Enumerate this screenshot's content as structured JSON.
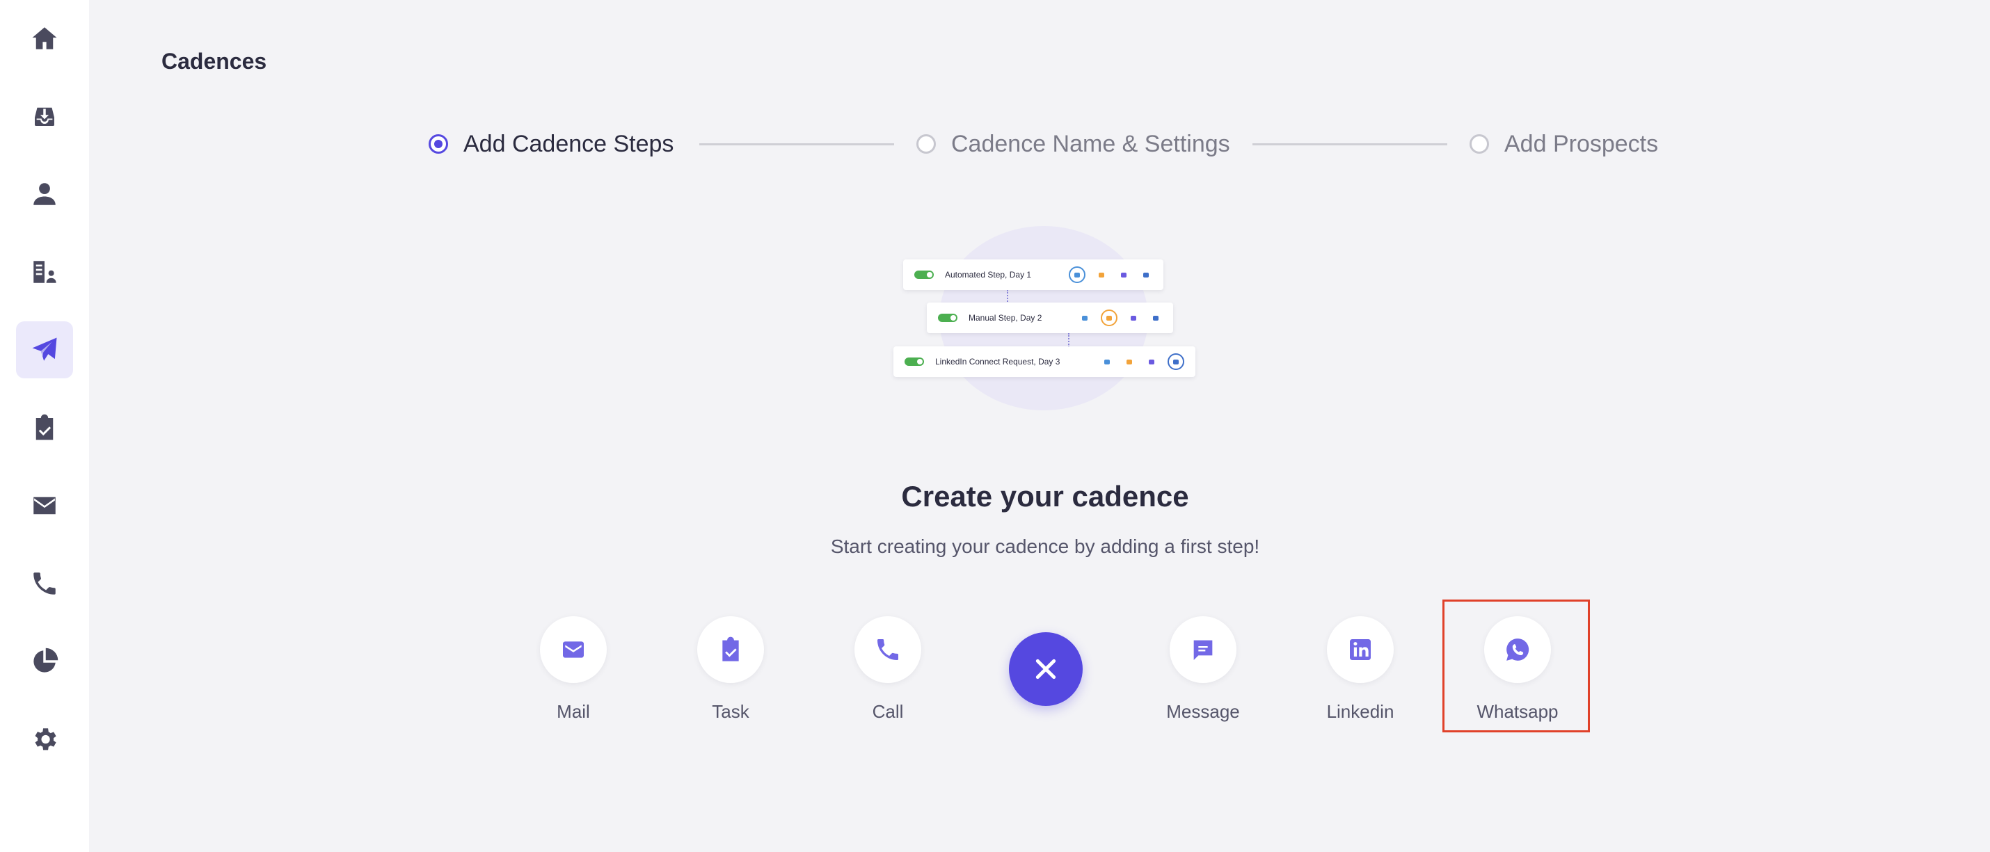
{
  "page": {
    "title": "Cadences"
  },
  "sidebar": {
    "items": [
      {
        "name": "home",
        "icon": "home-icon",
        "active": false
      },
      {
        "name": "inbox",
        "icon": "inbox-download-icon",
        "active": false
      },
      {
        "name": "contacts",
        "icon": "person-icon",
        "active": false
      },
      {
        "name": "companies",
        "icon": "building-icon",
        "active": false
      },
      {
        "name": "cadences",
        "icon": "paper-plane-icon",
        "active": true
      },
      {
        "name": "tasks",
        "icon": "clipboard-check-icon",
        "active": false
      },
      {
        "name": "mail",
        "icon": "envelope-icon",
        "active": false
      },
      {
        "name": "calls",
        "icon": "phone-icon",
        "active": false
      },
      {
        "name": "reports",
        "icon": "pie-chart-icon",
        "active": false
      },
      {
        "name": "settings",
        "icon": "gear-icon",
        "active": false
      }
    ]
  },
  "stepper": {
    "steps": [
      {
        "label": "Add Cadence Steps",
        "active": true
      },
      {
        "label": "Cadence Name & Settings",
        "active": false
      },
      {
        "label": "Add Prospects",
        "active": false
      }
    ]
  },
  "illustration": {
    "cards": [
      {
        "label": "Automated Step, Day 1",
        "selected_icon": "mail"
      },
      {
        "label": "Manual Step, Day 2",
        "selected_icon": "call"
      },
      {
        "label": "LinkedIn Connect Request, Day 3",
        "selected_icon": "linkedin"
      }
    ]
  },
  "main": {
    "heading": "Create your cadence",
    "subheading": "Start creating your cadence by adding a first step!"
  },
  "actions": [
    {
      "label": "Mail",
      "icon": "mail-icon"
    },
    {
      "label": "Task",
      "icon": "task-clipboard-icon"
    },
    {
      "label": "Call",
      "icon": "phone-icon"
    },
    {
      "label": "Message",
      "icon": "chat-message-icon"
    },
    {
      "label": "Linkedin",
      "icon": "linkedin-icon"
    },
    {
      "label": "Whatsapp",
      "icon": "whatsapp-icon"
    }
  ],
  "close_button": {
    "icon": "close-icon"
  },
  "colors": {
    "accent": "#5548e0",
    "icon_purple": "#7268e6",
    "sidebar_icon": "#4a4a5e",
    "highlight": "#e0412a",
    "toggle_green": "#4caf50",
    "mail_blue": "#4a90d9",
    "call_orange": "#f2a33a",
    "message_purple": "#6a5ae0",
    "linkedin_blue": "#3e6fc9"
  }
}
